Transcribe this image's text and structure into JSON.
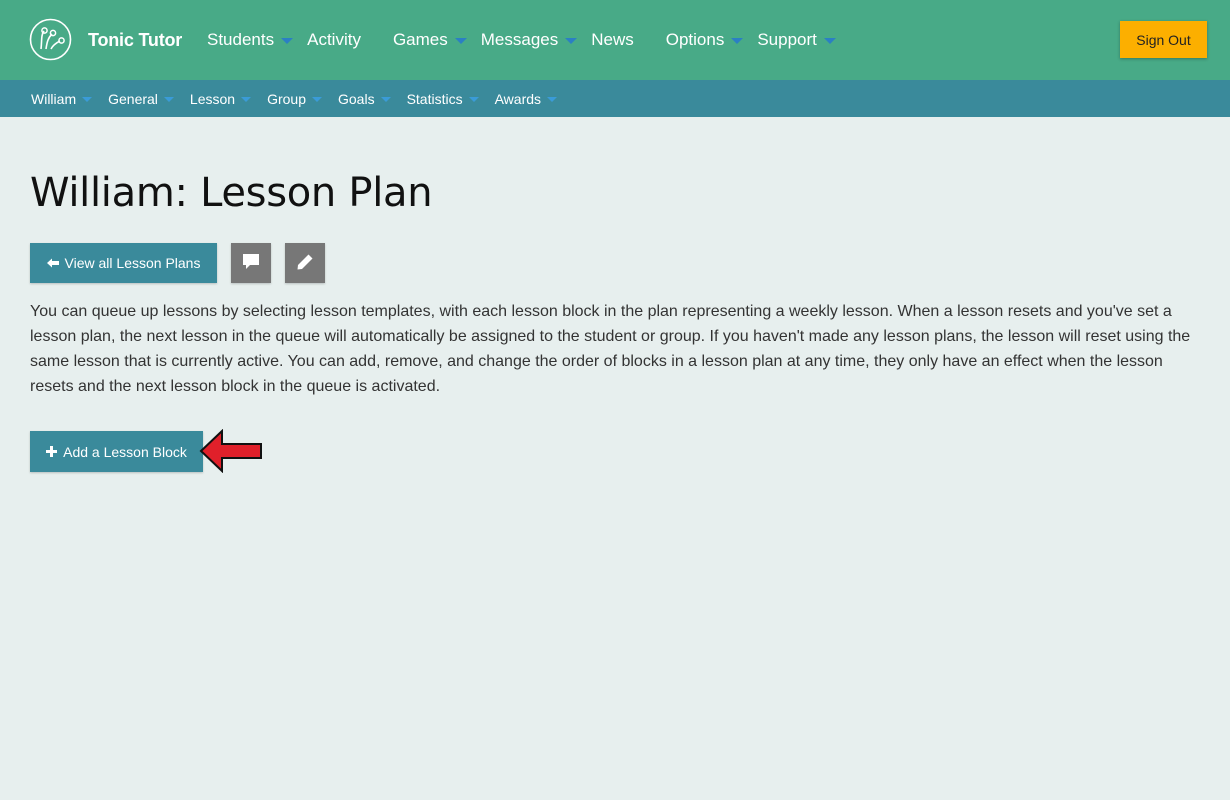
{
  "app": {
    "brand": "Tonic Tutor"
  },
  "main_nav": [
    {
      "label": "Students",
      "dropdown": true
    },
    {
      "label": "Activity",
      "dropdown": false
    },
    {
      "label": "Games",
      "dropdown": true
    },
    {
      "label": "Messages",
      "dropdown": true
    },
    {
      "label": "News",
      "dropdown": false
    },
    {
      "label": "Options",
      "dropdown": true
    },
    {
      "label": "Support",
      "dropdown": true
    }
  ],
  "sign_out_label": "Sign Out",
  "sub_nav": [
    {
      "label": "William"
    },
    {
      "label": "General"
    },
    {
      "label": "Lesson"
    },
    {
      "label": "Group"
    },
    {
      "label": "Goals"
    },
    {
      "label": "Statistics"
    },
    {
      "label": "Awards"
    }
  ],
  "page": {
    "title": "William: Lesson Plan",
    "view_all_label": "View all Lesson Plans",
    "description": "You can queue up lessons by selecting lesson templates, with each lesson block in the plan representing a weekly lesson. When a lesson resets and you've set a lesson plan, the next lesson in the queue will automatically be assigned to the student or group. If you haven't made any lesson plans, the lesson will reset using the same lesson that is currently active. You can add, remove, and change the order of blocks in a lesson plan at any time, they only have an effect when the lesson resets and the next lesson block in the queue is activated.",
    "add_block_label": "Add a Lesson Block"
  },
  "icons": {
    "logo": "tonic-tutor-logo-icon",
    "back": "arrow-left-icon",
    "comment": "comment-icon",
    "edit": "pencil-icon",
    "add": "plus-icon",
    "annotation": "red-arrow-icon"
  },
  "colors": {
    "topbar": "#48aa87",
    "subbar": "#3a8a9b",
    "primary_button": "#3a8a9b",
    "sign_out": "#fcaf00",
    "background": "#e7efee",
    "icon_button": "#777777",
    "annotation_arrow": "#e0202a"
  }
}
